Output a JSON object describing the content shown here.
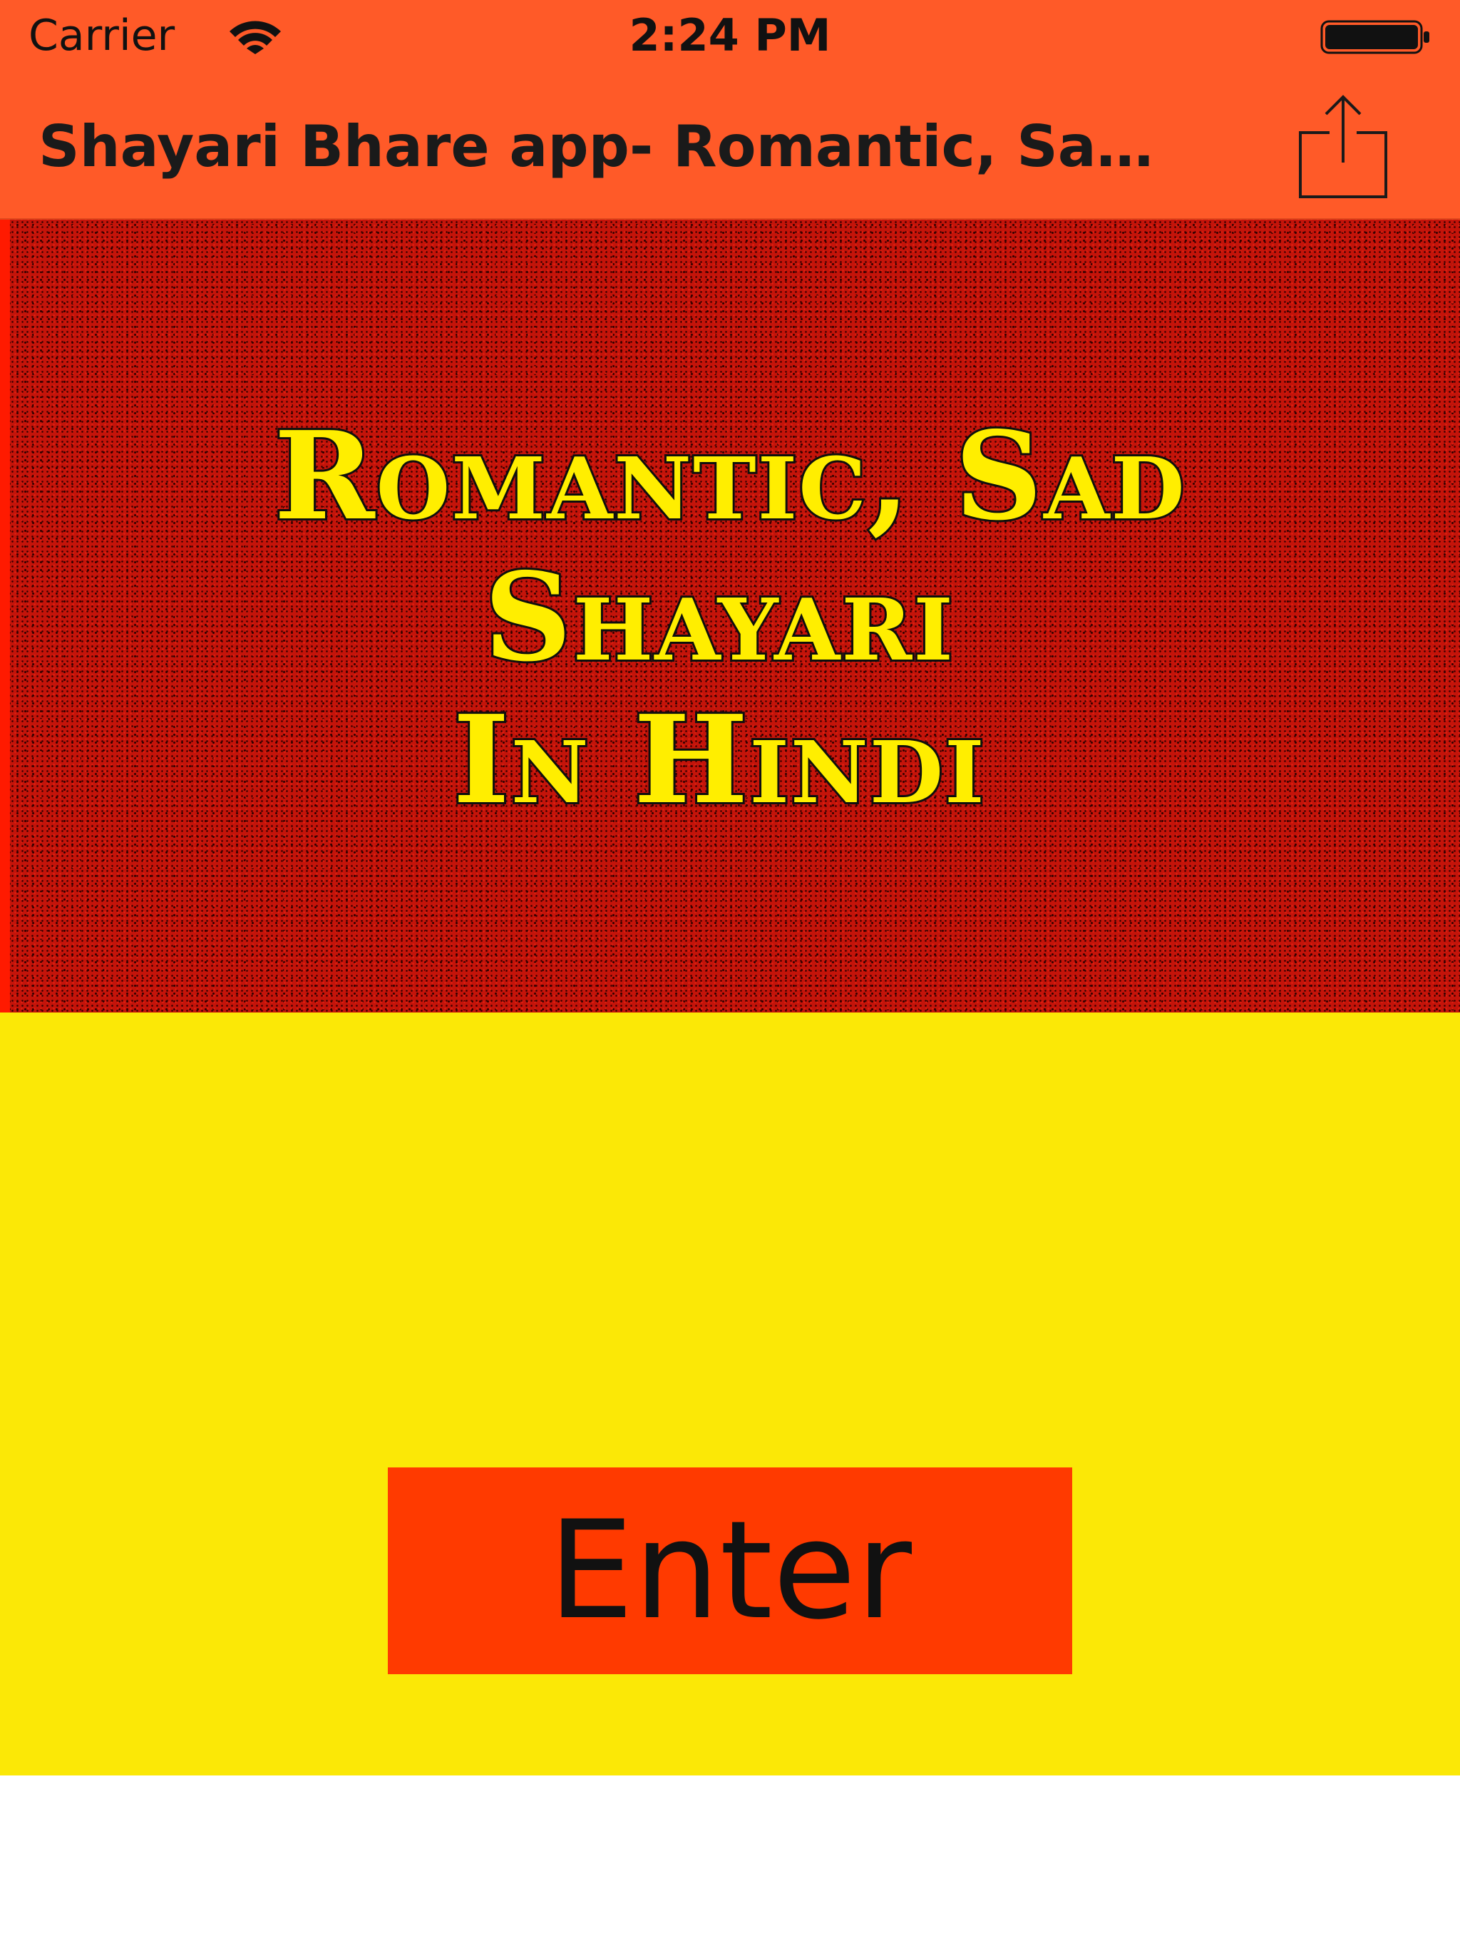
{
  "status_bar": {
    "carrier": "Carrier",
    "time": "2:24 PM",
    "wifi_icon": "wifi-icon",
    "battery_icon": "battery-icon"
  },
  "nav_bar": {
    "title": "Shayari Bhare app- Romantic, Sad Shayari In Hindi",
    "share_icon": "share-icon"
  },
  "banner": {
    "line1": "Romantic, Sad",
    "line2": "Shayari",
    "line3": "In Hindi"
  },
  "main": {
    "enter_label": "Enter"
  },
  "colors": {
    "bar_background": "#ff5a28",
    "banner_red": "#c4140a",
    "banner_text": "#ffee00",
    "content_yellow": "#fbe806",
    "button_background": "#ff3a00"
  }
}
